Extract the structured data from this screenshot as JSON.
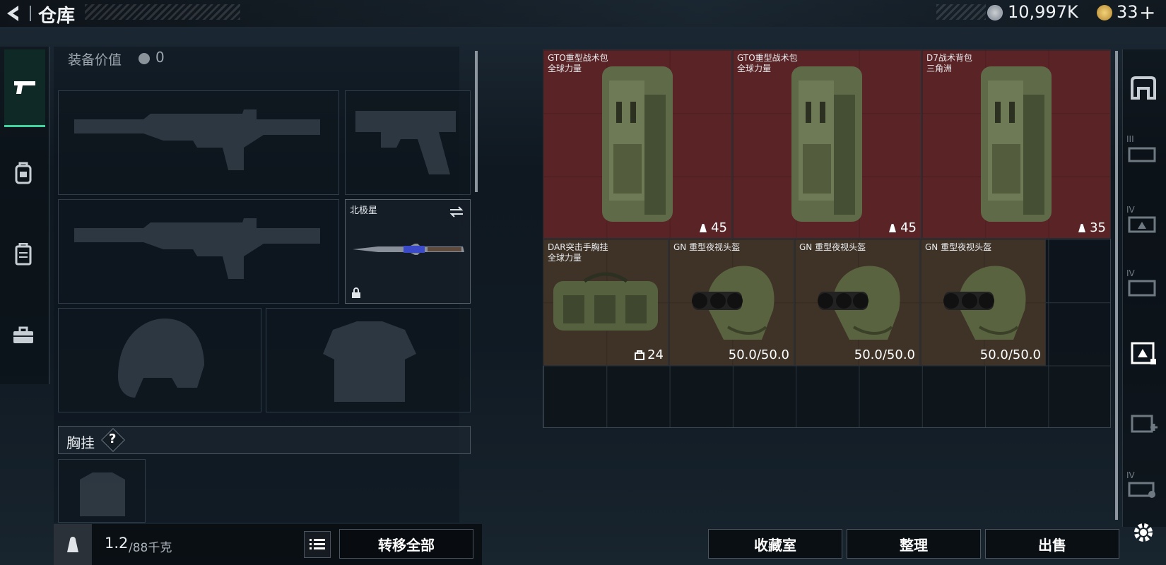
{
  "header": {
    "title": "仓库",
    "currency": "10,997K",
    "tickets": "33"
  },
  "left_rail": {
    "icons": [
      "pistol-icon",
      "backpack-icon",
      "chest-rig-icon",
      "toolbox-icon"
    ]
  },
  "equipment": {
    "value_label": "装备价值",
    "value": "0",
    "melee_name": "北极星",
    "chest_rig_label": "胸挂",
    "chest_rig_help": "?"
  },
  "bottom_left": {
    "weight": "1.2",
    "weight_max": "/88千克",
    "transfer_all": "转移全部"
  },
  "storage_items": [
    {
      "name": "GTO重型战术包",
      "brand": "全球力量",
      "count": "45",
      "count_icon": "weight-icon",
      "color": "#5a2326"
    },
    {
      "name": "GTO重型战术包",
      "brand": "全球力量",
      "count": "45",
      "count_icon": "weight-icon",
      "color": "#5a2326"
    },
    {
      "name": "D7战术背包",
      "brand": "三角洲",
      "count": "35",
      "count_icon": "weight-icon",
      "color": "#5a2326"
    },
    {
      "name": "DAR突击手胸挂",
      "brand": "全球力量",
      "count": "24",
      "count_icon": "capacity-icon",
      "color": "#3f3227"
    },
    {
      "name": "GN 重型夜视头盔",
      "brand": "",
      "count": "50.0/50.0",
      "count_icon": "",
      "color": "#3f3227"
    },
    {
      "name": "GN 重型夜视头盔",
      "brand": "",
      "count": "50.0/50.0",
      "count_icon": "",
      "color": "#3f3227"
    },
    {
      "name": "GN 重型夜视头盔",
      "brand": "",
      "count": "50.0/50.0",
      "count_icon": "",
      "color": "#3f3227"
    }
  ],
  "bottom_right": {
    "collection": "收藏室",
    "sort": "整理",
    "sell": "出售"
  },
  "right_rail": {
    "tier_labels": [
      "III",
      "IV",
      "IV",
      "IV"
    ]
  }
}
